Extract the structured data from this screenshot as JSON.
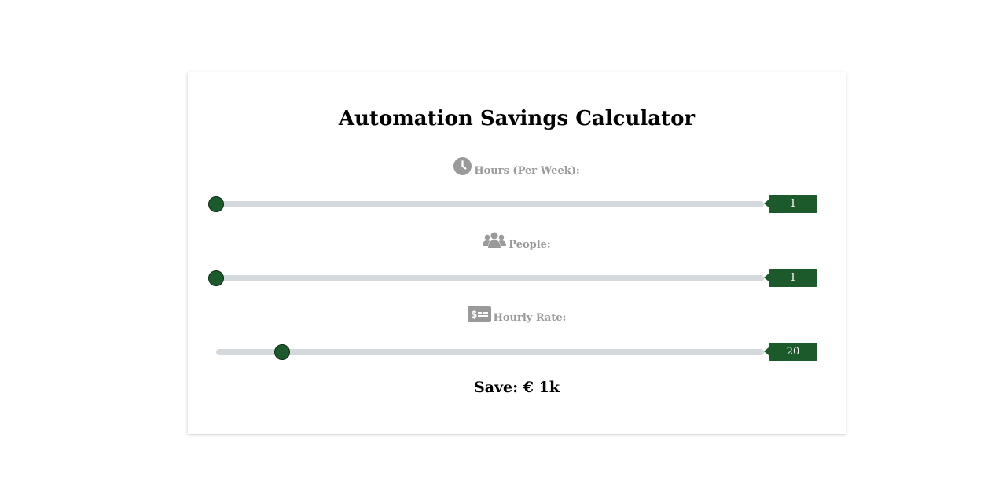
{
  "title": "Automation Savings Calculator",
  "fields": [
    {
      "icon": "clock-icon",
      "label": "Hours (Per Week):",
      "value": "1",
      "slider_fraction": 0.0
    },
    {
      "icon": "users-icon",
      "label": "People:",
      "value": "1",
      "slider_fraction": 0.0
    },
    {
      "icon": "money-bill-icon",
      "label": "Hourly Rate:",
      "value": "20",
      "slider_fraction": 0.12
    }
  ],
  "result": "Save: € 1k",
  "colors": {
    "accent": "#1d5a2b",
    "track": "#d3d9dd",
    "label": "#9a9a9a"
  }
}
